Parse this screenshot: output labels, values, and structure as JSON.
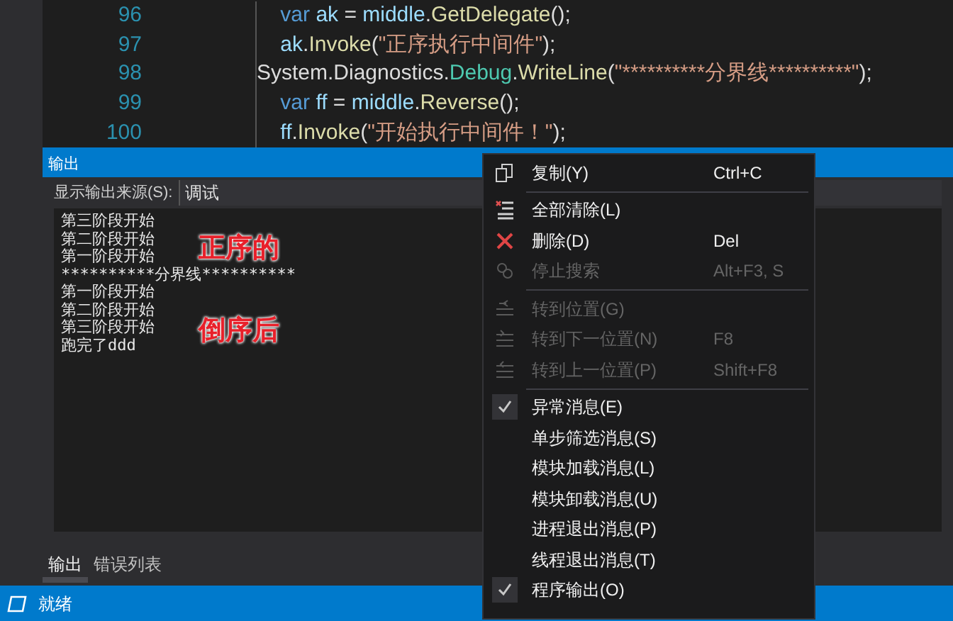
{
  "editor": {
    "lines": [
      {
        "number": "96",
        "tokens": [
          {
            "kind": "keyword",
            "text": "    var "
          },
          {
            "kind": "ident",
            "text": "ak"
          },
          {
            "kind": "plain",
            "text": " = "
          },
          {
            "kind": "ident",
            "text": "middle"
          },
          {
            "kind": "plain",
            "text": "."
          },
          {
            "kind": "method",
            "text": "GetDelegate"
          },
          {
            "kind": "plain",
            "text": "();"
          }
        ]
      },
      {
        "number": "97",
        "tokens": [
          {
            "kind": "ident",
            "text": "    ak"
          },
          {
            "kind": "plain",
            "text": "."
          },
          {
            "kind": "method",
            "text": "Invoke"
          },
          {
            "kind": "plain",
            "text": "("
          },
          {
            "kind": "string",
            "text": "\"正序执行中间件\""
          },
          {
            "kind": "plain",
            "text": ");"
          }
        ]
      },
      {
        "number": "98",
        "tokens": [
          {
            "kind": "plain",
            "text": "System.Diagnostics."
          },
          {
            "kind": "type",
            "text": "Debug"
          },
          {
            "kind": "plain",
            "text": "."
          },
          {
            "kind": "method",
            "text": "WriteLine"
          },
          {
            "kind": "plain",
            "text": "("
          },
          {
            "kind": "string",
            "text": "\"**********分界线**********\""
          },
          {
            "kind": "plain",
            "text": ");"
          }
        ]
      },
      {
        "number": "99",
        "tokens": [
          {
            "kind": "keyword",
            "text": "    var "
          },
          {
            "kind": "ident",
            "text": "ff"
          },
          {
            "kind": "plain",
            "text": " = "
          },
          {
            "kind": "ident",
            "text": "middle"
          },
          {
            "kind": "plain",
            "text": "."
          },
          {
            "kind": "method",
            "text": "Reverse"
          },
          {
            "kind": "plain",
            "text": "();"
          }
        ]
      },
      {
        "number": "100",
        "tokens": [
          {
            "kind": "ident",
            "text": "    ff"
          },
          {
            "kind": "plain",
            "text": "."
          },
          {
            "kind": "method",
            "text": "Invoke"
          },
          {
            "kind": "plain",
            "text": "("
          },
          {
            "kind": "string",
            "text": "\"开始执行中间件！\""
          },
          {
            "kind": "plain",
            "text": ");"
          }
        ]
      }
    ]
  },
  "output_panel": {
    "title": "输出",
    "source_label": "显示输出来源(S):",
    "source_value": "调试",
    "lines": [
      "第三阶段开始",
      "第二阶段开始",
      "第一阶段开始",
      "**********分界线**********",
      "第一阶段开始",
      "第二阶段开始",
      "第三阶段开始",
      "跑完了ddd"
    ],
    "annotations": [
      "正序的",
      "倒序后"
    ]
  },
  "bottom_tabs": [
    {
      "label": "输出",
      "selected": true
    },
    {
      "label": "错误列表",
      "selected": false
    }
  ],
  "status_bar": {
    "text": "就绪"
  },
  "context_menu": [
    {
      "kind": "item",
      "label": "复制(Y)",
      "shortcut": "Ctrl+C",
      "disabled": false
    },
    {
      "kind": "separator"
    },
    {
      "kind": "item",
      "label": "全部清除(L)",
      "disabled": false
    },
    {
      "kind": "item",
      "label": "删除(D)",
      "shortcut": "Del",
      "disabled": false
    },
    {
      "kind": "item",
      "label": "停止搜索",
      "shortcut": "Alt+F3, S",
      "disabled": true
    },
    {
      "kind": "separator"
    },
    {
      "kind": "item",
      "label": "转到位置(G)",
      "disabled": true
    },
    {
      "kind": "item",
      "label": "转到下一位置(N)",
      "shortcut": "F8",
      "disabled": true
    },
    {
      "kind": "item",
      "label": "转到上一位置(P)",
      "shortcut": "Shift+F8",
      "disabled": true
    },
    {
      "kind": "separator"
    },
    {
      "kind": "check",
      "label": "异常消息(E)",
      "checked": true
    },
    {
      "kind": "check",
      "label": "单步筛选消息(S)",
      "checked": false
    },
    {
      "kind": "check",
      "label": "模块加载消息(L)",
      "checked": false
    },
    {
      "kind": "check",
      "label": "模块卸载消息(U)",
      "checked": false
    },
    {
      "kind": "check",
      "label": "进程退出消息(P)",
      "checked": false
    },
    {
      "kind": "check",
      "label": "线程退出消息(T)",
      "checked": false
    },
    {
      "kind": "check",
      "label": "程序输出(O)",
      "checked": true
    }
  ]
}
